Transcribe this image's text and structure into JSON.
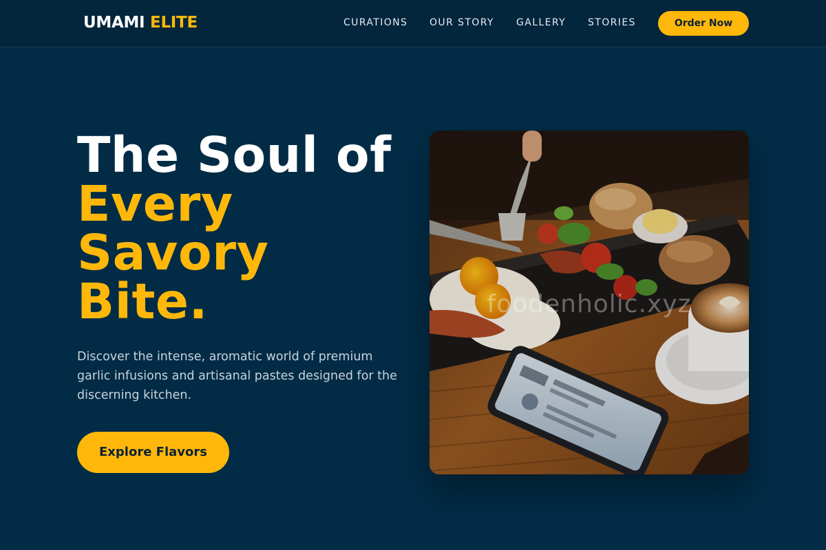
{
  "brand": {
    "part1": "UMAMI",
    "part2": "ELITE",
    "accent": "#ffb80a"
  },
  "nav": {
    "links": [
      "CURATIONS",
      "OUR STORY",
      "GALLERY",
      "STORIES"
    ],
    "cta": "Order Now"
  },
  "hero": {
    "title_line1": "The Soul of",
    "title_line2": "Every",
    "title_line3": "Savory",
    "title_line4": "Bite.",
    "description": "Discover the intense, aromatic world of premium garlic infusions and artisanal pastes designed for the discerning kitchen.",
    "cta": "Explore Flavors"
  },
  "image": {
    "watermark": "foodenholic.xyz"
  },
  "colors": {
    "background": "#022c46",
    "nav_background": "#04263d",
    "accent": "#ffb80a"
  }
}
